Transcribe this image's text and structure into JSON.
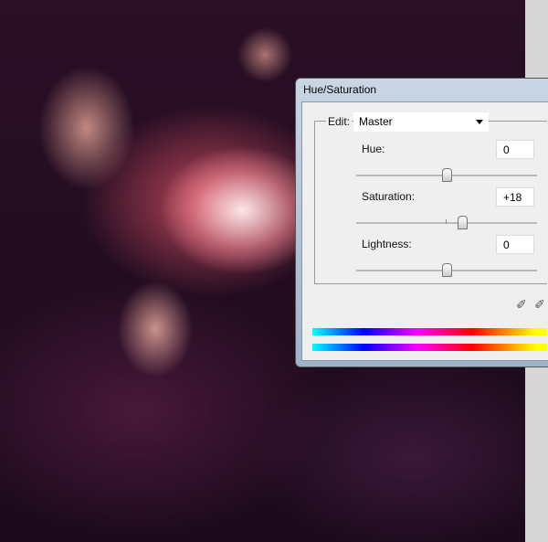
{
  "dialog": {
    "title": "Hue/Saturation",
    "edit_label": "Edit:",
    "edit_value": "Master",
    "hue": {
      "label": "Hue:",
      "value": "0",
      "slider": 0
    },
    "saturation": {
      "label": "Saturation:",
      "value": "+18",
      "slider": 18
    },
    "lightness": {
      "label": "Lightness:",
      "value": "0",
      "slider": 0
    },
    "slider_range": [
      -100,
      100
    ]
  }
}
